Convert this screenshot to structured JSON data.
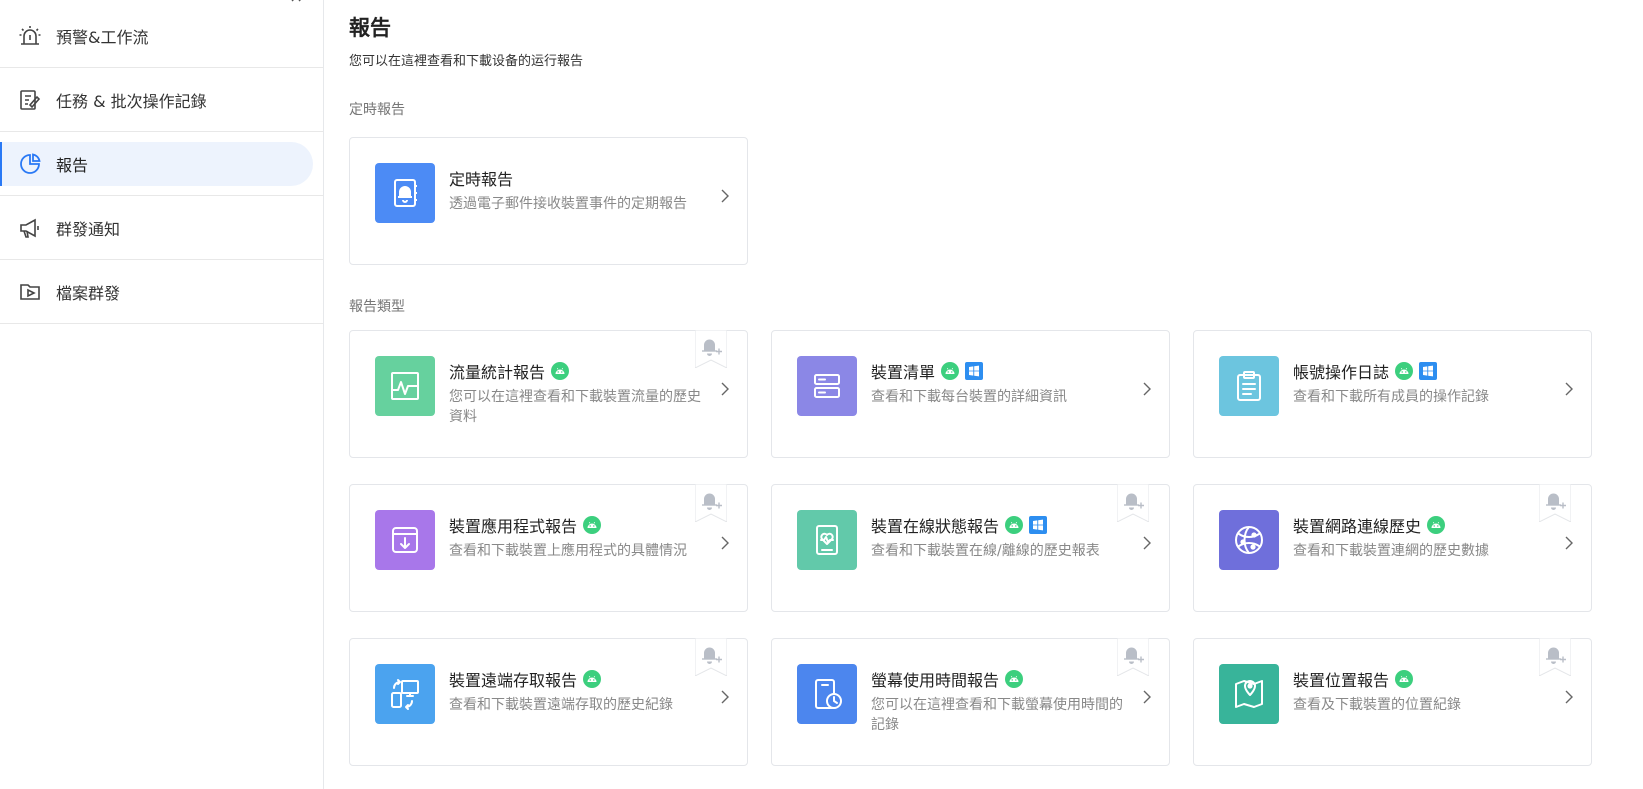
{
  "sidebar": {
    "items": [
      {
        "label": "預警&工作流",
        "icon": "alarm-icon"
      },
      {
        "label": "任務 & 批次操作記錄",
        "icon": "task-log-icon"
      },
      {
        "label": "報告",
        "icon": "pie-chart-icon",
        "active": true
      },
      {
        "label": "群發通知",
        "icon": "megaphone-icon"
      },
      {
        "label": "檔案群發",
        "icon": "file-send-icon"
      }
    ],
    "collapse_icon": "double-chevron-left-icon"
  },
  "page": {
    "title": "報告",
    "subtitle": "您可以在這裡查看和下載设备的运行報告"
  },
  "sections": {
    "scheduled": "定時報告",
    "types": "報告類型"
  },
  "scheduled_card": {
    "title": "定時報告",
    "desc": "透過電子郵件接收裝置事件的定期報告",
    "color": "#4c8bf5",
    "icon": "bell-notebook-icon"
  },
  "report_cards": [
    {
      "title": "流量統計報告",
      "desc": "您可以在這裡查看和下載裝置流量的歷史資料",
      "color": "#66d19e",
      "icon": "traffic-chart-icon",
      "android": true,
      "windows": false,
      "subscribe": true
    },
    {
      "title": "裝置清單",
      "desc": "查看和下載每台裝置的詳細資訊",
      "color": "#8b87e6",
      "icon": "server-list-icon",
      "android": true,
      "windows": true,
      "subscribe": false
    },
    {
      "title": "帳號操作日誌",
      "desc": "查看和下載所有成員的操作記錄",
      "color": "#6cc5df",
      "icon": "clipboard-icon",
      "android": true,
      "windows": true,
      "subscribe": false
    },
    {
      "title": "裝置應用程式報告",
      "desc": "查看和下載裝置上應用程式的具體情況",
      "color": "#a877ea",
      "icon": "app-download-icon",
      "android": true,
      "windows": false,
      "subscribe": true
    },
    {
      "title": "裝置在線狀態報告",
      "desc": "查看和下載裝置在線/離線的歷史報表",
      "color": "#62c9aa",
      "icon": "device-heart-icon",
      "android": true,
      "windows": true,
      "subscribe": true
    },
    {
      "title": "裝置網路連線歷史",
      "desc": "查看和下載裝置連網的歷史數據",
      "color": "#6f6fdb",
      "icon": "globe-network-icon",
      "android": true,
      "windows": false,
      "subscribe": true
    },
    {
      "title": "裝置遠端存取報告",
      "desc": "查看和下載裝置遠端存取的歷史紀錄",
      "color": "#4ba3ef",
      "icon": "remote-access-icon",
      "android": true,
      "windows": false,
      "subscribe": true
    },
    {
      "title": "螢幕使用時間報告",
      "desc": "您可以在這裡查看和下載螢幕使用時間的記錄",
      "color": "#4c86ee",
      "icon": "screen-time-icon",
      "android": true,
      "windows": false,
      "subscribe": true
    },
    {
      "title": "裝置位置報告",
      "desc": "查看及下載裝置的位置紀錄",
      "color": "#38b49a",
      "icon": "location-map-icon",
      "android": true,
      "windows": false,
      "subscribe": true
    }
  ],
  "colors": {
    "accent": "#2a79f5",
    "active_bg": "#edf3fd",
    "android": "#3ccf7e",
    "windows": "#2d8ef0"
  }
}
